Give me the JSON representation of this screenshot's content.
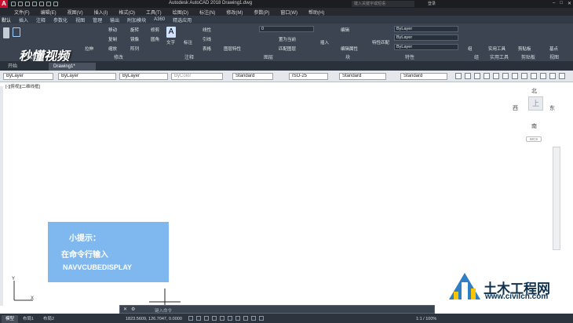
{
  "window": {
    "title": "Autodesk AutoCAD 2018    Drawing1.dwg",
    "search_placeholder": "键入关键字或短语",
    "user": "登录",
    "logo": "A"
  },
  "menubar": [
    "文件(F)",
    "编辑(E)",
    "视图(V)",
    "插入(I)",
    "格式(O)",
    "工具(T)",
    "绘图(D)",
    "标注(N)",
    "修改(M)",
    "参数(P)",
    "窗口(W)",
    "帮助(H)"
  ],
  "ribbon_tabs": [
    "默认",
    "插入",
    "注释",
    "参数化",
    "视图",
    "管理",
    "输出",
    "附加模块",
    "A360",
    "精选应用"
  ],
  "ribbon": {
    "watermark": "秒懂视频",
    "tools": [
      "移动",
      "旋转",
      "修剪",
      "复制",
      "镜像",
      "圆角",
      "拉伸",
      "缩放",
      "阵列",
      "文字",
      "标注",
      "线性",
      "引线",
      "表格",
      "图层特性",
      "插入",
      "编辑",
      "编辑属性",
      "特性匹配",
      "组",
      "实用工具",
      "剪贴板",
      "基点"
    ],
    "layer_value": "0",
    "layer_tools": [
      "置为当前",
      "匹配图层"
    ],
    "prop_values": [
      "ByLayer",
      "ByLayer",
      "ByLayer"
    ],
    "panels": [
      "绘图",
      "修改",
      "注释",
      "图层",
      "块",
      "特性",
      "组",
      "实用工具",
      "剪贴板",
      "视图"
    ]
  },
  "file_tabs": [
    "开始",
    "Drawing1*"
  ],
  "properties_bar": {
    "color": "ByLayer",
    "linetype": "ByLayer",
    "lineweight": "ByLayer",
    "plotstyle": "ByColor",
    "text_style": "Standard",
    "dim_style": "ISO-25",
    "table_style": "Standard",
    "mleader_style": "Standard"
  },
  "canvas": {
    "viewport_label": "[-][俯视][二维线框]",
    "viewcube": {
      "north": "北",
      "south": "南",
      "east": "东",
      "west": "西",
      "face": "上",
      "wcs": "WCS"
    },
    "ucs_y": "Y",
    "ucs_x": "X"
  },
  "tip": {
    "title": "小提示：",
    "line1": "在命令行输入",
    "line2": "NAVVCUBEDISPLAY"
  },
  "site_logo": {
    "name": "土木工程网",
    "url": "www.civilcn.com"
  },
  "command_line": {
    "placeholder": "键入命令"
  },
  "layout_tabs": [
    "模型",
    "布局1",
    "布局2"
  ],
  "status": {
    "coords": "1823.5609, 126.7047, 0.0000",
    "mode": "模型",
    "scale": "1:1 / 100%"
  }
}
